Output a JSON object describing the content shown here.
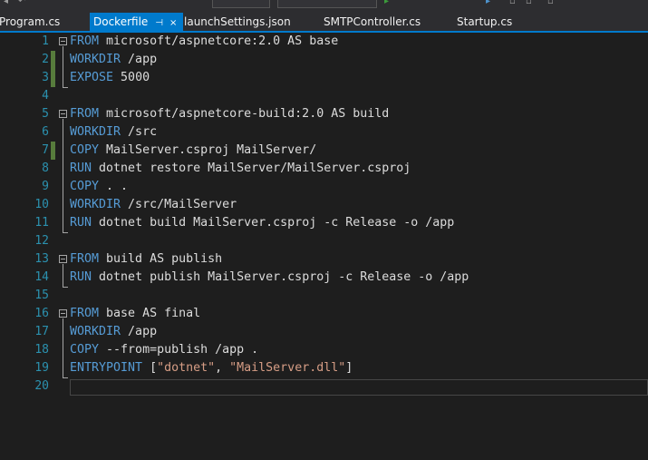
{
  "tabs": [
    {
      "label": "Program.cs",
      "active": false
    },
    {
      "label": "Dockerfile",
      "active": true,
      "pin": "⊣",
      "close": "×"
    },
    {
      "label": "launchSettings.json",
      "active": false
    },
    {
      "label": "SMTPController.cs",
      "active": false
    },
    {
      "label": "Startup.cs",
      "active": false
    }
  ],
  "lines": [
    {
      "num": "1",
      "tokens": [
        {
          "t": "FROM",
          "c": "kw"
        },
        {
          "t": " microsoft/aspnetcore:2.0 AS base",
          "c": ""
        }
      ]
    },
    {
      "num": "2",
      "tokens": [
        {
          "t": "WORKDIR",
          "c": "kw"
        },
        {
          "t": " /app",
          "c": ""
        }
      ]
    },
    {
      "num": "3",
      "tokens": [
        {
          "t": "EXPOSE",
          "c": "kw"
        },
        {
          "t": " 5000",
          "c": ""
        }
      ]
    },
    {
      "num": "4",
      "tokens": []
    },
    {
      "num": "5",
      "tokens": [
        {
          "t": "FROM",
          "c": "kw"
        },
        {
          "t": " microsoft/aspnetcore-build:2.0 AS build",
          "c": ""
        }
      ]
    },
    {
      "num": "6",
      "tokens": [
        {
          "t": "WORKDIR",
          "c": "kw"
        },
        {
          "t": " /src",
          "c": ""
        }
      ]
    },
    {
      "num": "7",
      "tokens": [
        {
          "t": "COPY",
          "c": "kw"
        },
        {
          "t": " MailServer.csproj MailServer/",
          "c": ""
        }
      ]
    },
    {
      "num": "8",
      "tokens": [
        {
          "t": "RUN",
          "c": "kw"
        },
        {
          "t": " dotnet restore MailServer/MailServer.csproj",
          "c": ""
        }
      ]
    },
    {
      "num": "9",
      "tokens": [
        {
          "t": "COPY",
          "c": "kw"
        },
        {
          "t": " . .",
          "c": ""
        }
      ]
    },
    {
      "num": "10",
      "tokens": [
        {
          "t": "WORKDIR",
          "c": "kw"
        },
        {
          "t": " /src/MailServer",
          "c": ""
        }
      ]
    },
    {
      "num": "11",
      "tokens": [
        {
          "t": "RUN",
          "c": "kw"
        },
        {
          "t": " dotnet build MailServer.csproj -c Release -o /app",
          "c": ""
        }
      ]
    },
    {
      "num": "12",
      "tokens": []
    },
    {
      "num": "13",
      "tokens": [
        {
          "t": "FROM",
          "c": "kw"
        },
        {
          "t": " build AS publish",
          "c": ""
        }
      ]
    },
    {
      "num": "14",
      "tokens": [
        {
          "t": "RUN",
          "c": "kw"
        },
        {
          "t": " dotnet publish MailServer.csproj -c Release -o /app",
          "c": ""
        }
      ]
    },
    {
      "num": "15",
      "tokens": []
    },
    {
      "num": "16",
      "tokens": [
        {
          "t": "FROM",
          "c": "kw"
        },
        {
          "t": " base AS final",
          "c": ""
        }
      ]
    },
    {
      "num": "17",
      "tokens": [
        {
          "t": "WORKDIR",
          "c": "kw"
        },
        {
          "t": " /app",
          "c": ""
        }
      ]
    },
    {
      "num": "18",
      "tokens": [
        {
          "t": "COPY",
          "c": "kw"
        },
        {
          "t": " --from=publish /app .",
          "c": ""
        }
      ]
    },
    {
      "num": "19",
      "tokens": [
        {
          "t": "ENTRYPOINT",
          "c": "kw"
        },
        {
          "t": " [",
          "c": ""
        },
        {
          "t": "\"dotnet\"",
          "c": "str"
        },
        {
          "t": ", ",
          "c": ""
        },
        {
          "t": "\"MailServer.dll\"",
          "c": "str"
        },
        {
          "t": "]",
          "c": ""
        }
      ]
    },
    {
      "num": "20",
      "tokens": []
    }
  ],
  "modified_lines": [
    "2",
    "3",
    "7"
  ],
  "colors": {
    "background": "#1e1e1e",
    "keyword": "#569cd6",
    "string": "#d69d85",
    "line_number": "#2b91af",
    "accent": "#007acc"
  }
}
